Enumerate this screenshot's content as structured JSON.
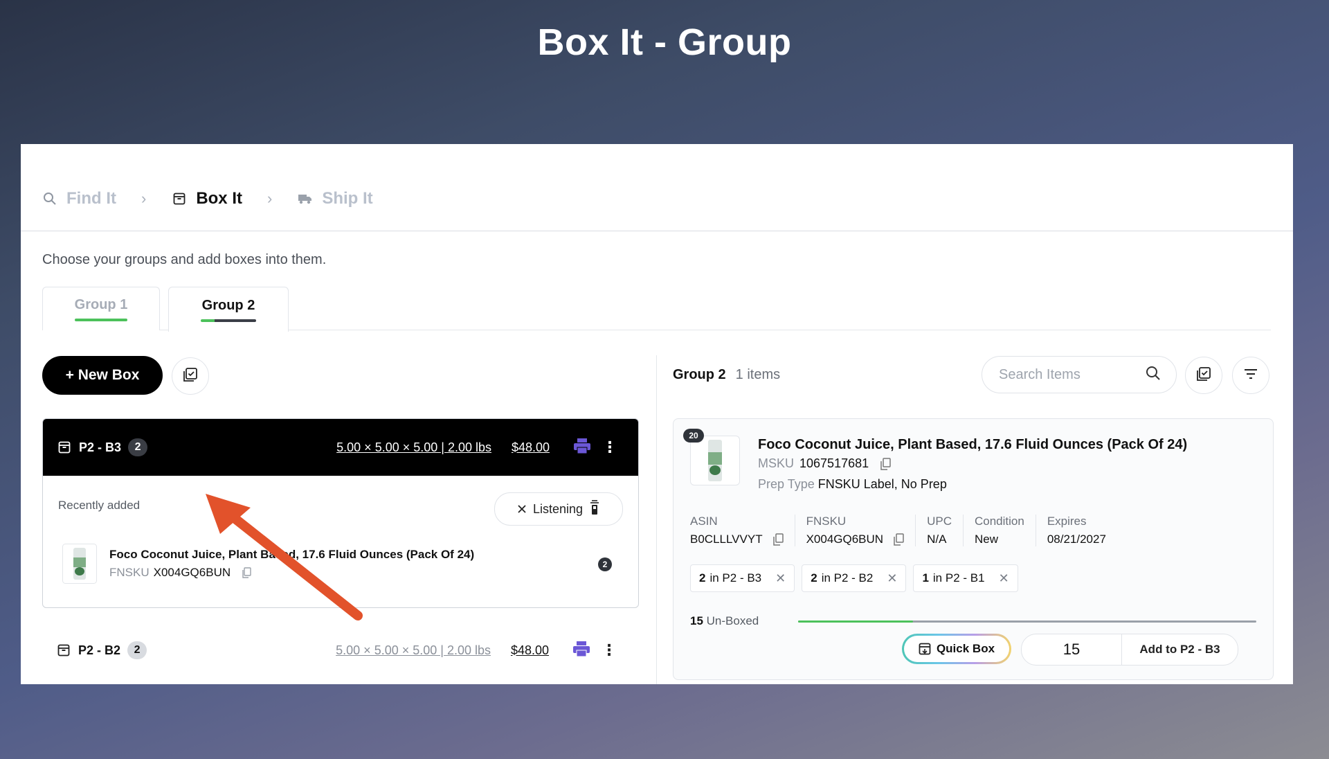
{
  "slide_title": "Box It - Group",
  "breadcrumb": {
    "steps": [
      {
        "label": "Find It",
        "icon": "search-icon",
        "active": false
      },
      {
        "label": "Box It",
        "icon": "box-icon",
        "active": true
      },
      {
        "label": "Ship It",
        "icon": "truck-icon",
        "active": false
      }
    ]
  },
  "subtitle": "Choose your groups and add boxes into them.",
  "tabs": [
    {
      "label": "Group 1",
      "active": false
    },
    {
      "label": "Group 2",
      "active": true
    }
  ],
  "left": {
    "new_box_label": "+ New Box",
    "boxes": [
      {
        "name": "P2 - B3",
        "count": "2",
        "dims": "5.00 × 5.00 × 5.00 | 2.00 lbs",
        "price": "$48.00",
        "recent_label": "Recently added",
        "listening_label": "Listening",
        "item": {
          "title": "Foco Coconut Juice, Plant Based, 17.6 Fluid Ounces (Pack Of 24)",
          "fnsku_label": "FNSKU",
          "fnsku": "X004GQ6BUN",
          "qty": "2"
        }
      },
      {
        "name": "P2 - B2",
        "count": "2",
        "dims": "5.00 × 5.00 × 5.00 | 2.00 lbs",
        "price": "$48.00"
      }
    ]
  },
  "right": {
    "group_name": "Group 2",
    "item_count": "1 items",
    "search_placeholder": "Search Items",
    "product": {
      "qty_badge": "20",
      "title": "Foco Coconut Juice, Plant Based, 17.6 Fluid Ounces (Pack Of 24)",
      "msku_label": "MSKU",
      "msku": "1067517681",
      "prep_label": "Prep Type",
      "prep": "FNSKU Label, No Prep",
      "attributes": [
        {
          "key": "ASIN",
          "value": "B0CLLLVVYT",
          "copy": true
        },
        {
          "key": "FNSKU",
          "value": "X004GQ6BUN",
          "copy": true
        },
        {
          "key": "UPC",
          "value": "N/A",
          "copy": false
        },
        {
          "key": "Condition",
          "value": "New",
          "copy": false
        },
        {
          "key": "Expires",
          "value": "08/21/2027",
          "copy": false
        }
      ],
      "chips": [
        {
          "qty": "2",
          "text": "in P2 - B3"
        },
        {
          "qty": "2",
          "text": "in P2 - B2"
        },
        {
          "qty": "1",
          "text": "in P2 - B1"
        }
      ],
      "unboxed_qty": "15",
      "unboxed_label": "Un-Boxed",
      "boxed_fraction": 0.25,
      "quick_box_label": "Quick Box",
      "add_qty": "15",
      "add_label": "Add to P2 - B3"
    }
  },
  "colors": {
    "accent_green": "#4cc15b",
    "printer_purple": "#6b57d6",
    "arrow_orange": "#e2522b"
  }
}
